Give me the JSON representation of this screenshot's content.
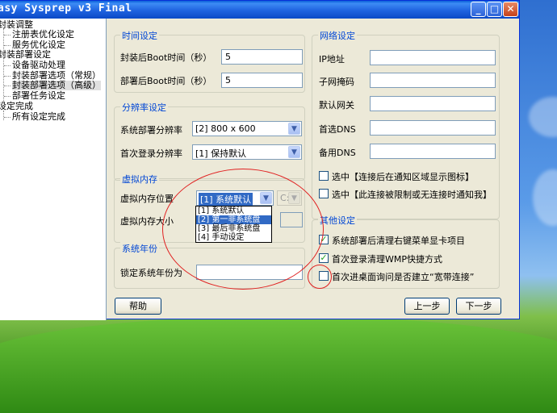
{
  "window": {
    "title": "asy Sysprep v3 Final"
  },
  "tree": {
    "items": [
      "封装调整",
      "注册表优化设定",
      "服务优化设定",
      "封装部署设定",
      "设备驱动处理",
      "封装部署选项（常规）",
      "封装部署选项（高级）",
      "部署任务设定",
      "设定完成",
      "所有设定完成"
    ]
  },
  "time_settings": {
    "title": "时间设定",
    "after_pack_label": "封装后Boot时间（秒）",
    "after_pack_value": "5",
    "after_deploy_label": "部署后Boot时间（秒）",
    "after_deploy_value": "5"
  },
  "resolution": {
    "title": "分辨率设定",
    "deploy_label": "系统部署分辨率",
    "deploy_value": "[2] 800 x 600",
    "first_login_label": "首次登录分辨率",
    "first_login_value": "[1] 保持默认"
  },
  "virtual_memory": {
    "title": "虚拟内存",
    "location_label": "虚拟内存位置",
    "location_value": "[1] 系统默认",
    "drive_value": "C:",
    "size_label": "虚拟内存大小",
    "options": [
      "[1] 系统默认",
      "[2] 第一非系统盘",
      "[3] 最后非系统盘",
      "[4] 手动设定"
    ]
  },
  "system_year": {
    "title": "系统年份",
    "lock_label": "锁定系统年份为"
  },
  "network": {
    "title": "网络设定",
    "ip_label": "IP地址",
    "mask_label": "子网掩码",
    "gateway_label": "默认网关",
    "dns1_label": "首选DNS",
    "dns2_label": "备用DNS",
    "show_icon_label": "选中【连接后在通知区域显示图标】",
    "notify_label": "选中【此连接被限制或无连接时通知我】"
  },
  "other": {
    "title": "其他设定",
    "opt1_label": "系统部署后清理右键菜单显卡项目",
    "opt2_label": "首次登录清理WMP快捷方式",
    "opt3_label": "首次进桌面询问是否建立“宽带连接”"
  },
  "buttons": {
    "help": "帮助",
    "prev": "上一步",
    "next": "下一步"
  }
}
